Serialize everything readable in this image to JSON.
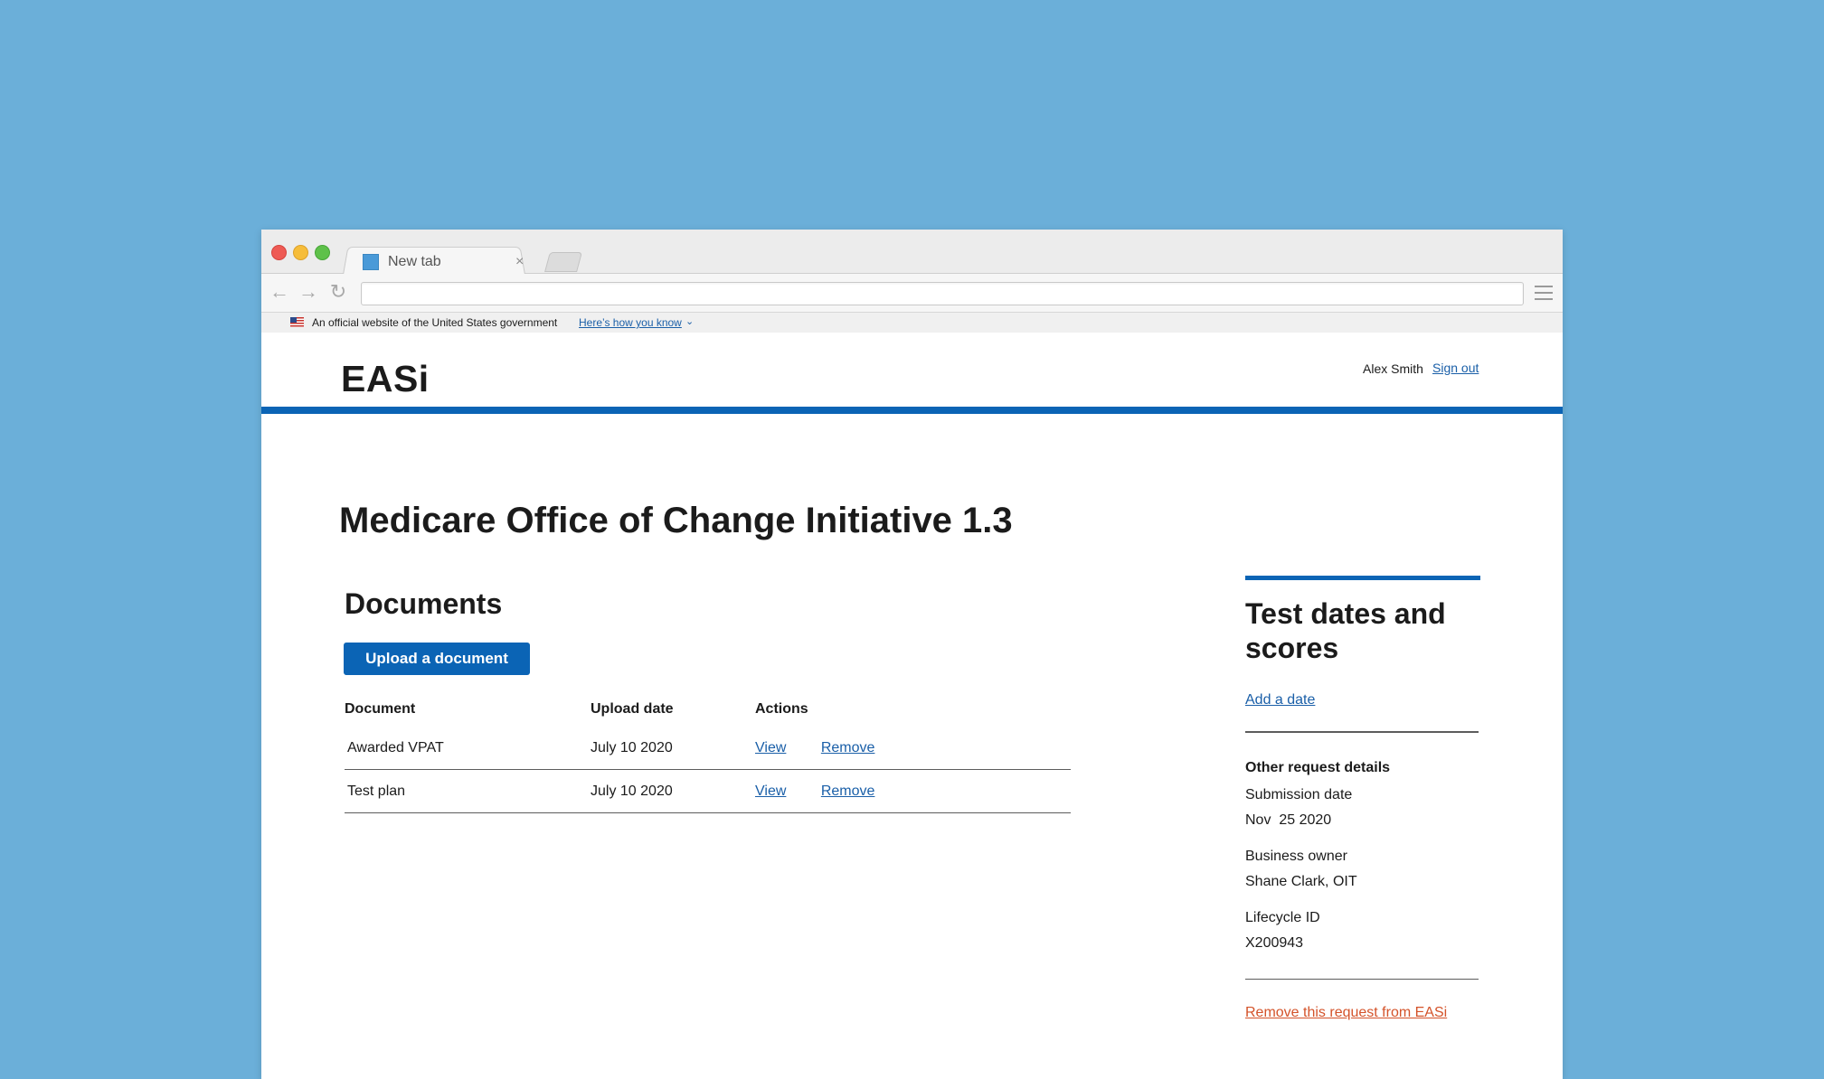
{
  "browser": {
    "tab_title": "New tab",
    "tab_close": "×",
    "address_value": ""
  },
  "gov_banner": {
    "text": "An official website of the United States government",
    "link": "Here’s how you know",
    "chevron": "⌄"
  },
  "header": {
    "logo": "EASi",
    "user_name": "Alex Smith",
    "sign_out": "Sign out"
  },
  "main": {
    "title": "Medicare Office of Change Initiative 1.3",
    "documents": {
      "heading": "Documents",
      "upload_button": "Upload a document",
      "columns": [
        "Document",
        "Upload date",
        "Actions"
      ],
      "rows": [
        {
          "name": "Awarded VPAT",
          "date": "July 10 2020",
          "view": "View",
          "remove": "Remove"
        },
        {
          "name": "Test plan",
          "date": "July 10 2020",
          "view": "View",
          "remove": "Remove"
        }
      ]
    }
  },
  "sidebar": {
    "heading": "Test dates and scores",
    "add_date": "Add a date",
    "other_heading": "Other request details",
    "details": [
      {
        "label": "Submission date",
        "value": "Nov  25 2020"
      },
      {
        "label": "Business owner",
        "value": "Shane Clark, OIT"
      },
      {
        "label": "Lifecycle ID",
        "value": "X200943"
      }
    ],
    "remove_request": "Remove this request from EASi"
  },
  "colors": {
    "background": "#6bafd9",
    "primary": "#0b64b5",
    "link": "#1a5fa8",
    "danger_link": "#d4532a"
  }
}
